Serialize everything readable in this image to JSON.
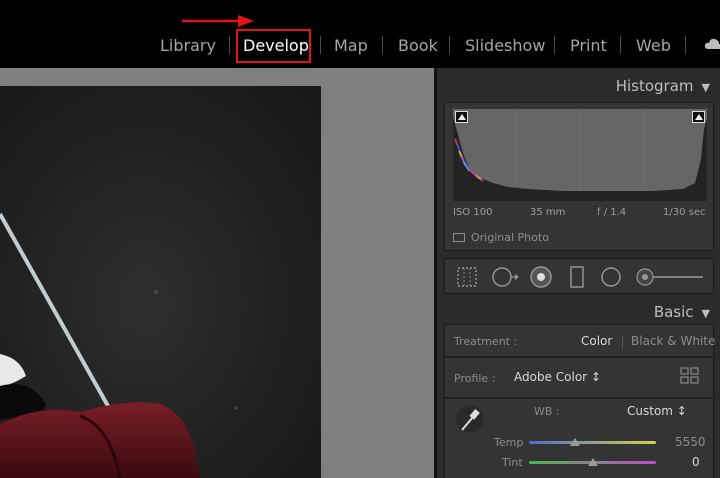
{
  "modules": {
    "library": "Library",
    "develop": "Develop",
    "map": "Map",
    "book": "Book",
    "slideshow": "Slideshow",
    "print": "Print",
    "web": "Web"
  },
  "histogram": {
    "title": "Histogram",
    "iso": "ISO 100",
    "focal": "35 mm",
    "aperture": "f / 1.4",
    "shutter": "1/30 sec",
    "original_photo": "Original Photo"
  },
  "basic": {
    "title": "Basic",
    "treatment_label": "Treatment :",
    "treatment_color": "Color",
    "treatment_bw": "Black & White",
    "profile_label": "Profile :",
    "profile_value": "Adobe Color ↕",
    "wb_label": "WB :",
    "wb_value": "Custom ↕",
    "temp_label": "Temp",
    "temp_value": "5550",
    "temp_level": 0.36,
    "tint_label": "Tint",
    "tint_value": "0",
    "tint_level": 0.5
  },
  "colors": {
    "annotation_red": "#e01414",
    "temp_gradient_start": "#4a6fd0",
    "temp_gradient_end": "#d8d04a",
    "tint_gradient_start": "#4cb84c",
    "tint_gradient_end": "#c24cc8"
  },
  "icons": [
    "arrow-annotation",
    "cloud-icon",
    "clip-indicator-icon",
    "crop-tool-icon",
    "spot-removal-icon",
    "red-eye-icon",
    "graduated-filter-icon",
    "radial-filter-icon",
    "adjustment-brush-icon",
    "eyedropper-icon",
    "collapse-triangle-icon",
    "grid-icon"
  ]
}
